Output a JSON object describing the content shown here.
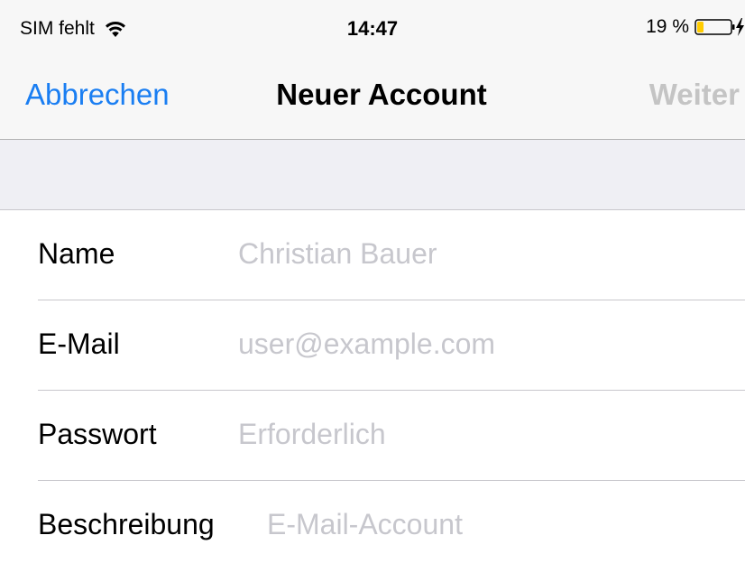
{
  "status_bar": {
    "carrier": "SIM fehlt",
    "time": "14:47",
    "battery_percent": "19 %",
    "battery_level": 0.19,
    "wifi_icon": "wifi-icon",
    "battery_icon": "battery-icon",
    "charging_icon": "charging-bolt-icon"
  },
  "nav": {
    "cancel_label": "Abbrechen",
    "title": "Neuer Account",
    "next_label": "Weiter"
  },
  "form": {
    "rows": [
      {
        "label": "Name",
        "value": "",
        "placeholder": "Christian Bauer"
      },
      {
        "label": "E-Mail",
        "value": "",
        "placeholder": "user@example.com"
      },
      {
        "label": "Passwort",
        "value": "",
        "placeholder": "Erforderlich"
      },
      {
        "label": "Beschreibung",
        "value": "",
        "placeholder": "E-Mail-Account"
      }
    ]
  },
  "colors": {
    "accent": "#1a7ef2",
    "disabled": "#c4c4c4",
    "placeholder": "#c7c7cd",
    "battery_low": "#ffcc00"
  }
}
